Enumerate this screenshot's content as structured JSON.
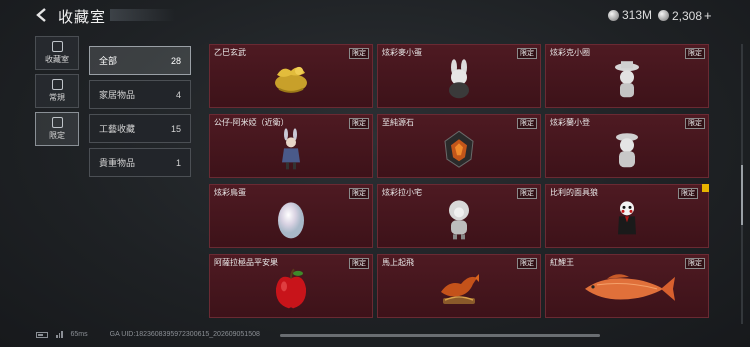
{
  "header": {
    "title": "收藏室",
    "back_icon": "back-arrow-icon"
  },
  "currency": [
    {
      "icon": "silver-coin-icon",
      "value": "313M"
    },
    {
      "icon": "silver-coin-icon",
      "value": "2,308",
      "plus": "+"
    }
  ],
  "nav_tabs": [
    {
      "label": "收藏室",
      "icon": "collection-room-icon",
      "active": false
    },
    {
      "label": "常規",
      "icon": "regular-icon",
      "active": false
    },
    {
      "label": "限定",
      "icon": "limited-icon",
      "active": true
    }
  ],
  "categories": [
    {
      "label": "全部",
      "count": "28",
      "active": true
    },
    {
      "label": "家居物品",
      "count": "4",
      "active": false
    },
    {
      "label": "工藝收藏",
      "count": "15",
      "active": false
    },
    {
      "label": "貴重物品",
      "count": "1",
      "active": false
    }
  ],
  "items": [
    {
      "name": "乙巳玄武",
      "badge": "限定",
      "icon": "golden-dragon-figurine-icon",
      "warn": false
    },
    {
      "name": "炫彩麥小蛋",
      "badge": "限定",
      "icon": "rabbit-egg-figurine-icon",
      "warn": false
    },
    {
      "name": "炫彩克小圈",
      "badge": "限定",
      "icon": "hat-figurine-icon",
      "warn": false
    },
    {
      "name": "公仔-阿米婭（近衛）",
      "badge": "限定",
      "icon": "amiya-figure-icon",
      "warn": false
    },
    {
      "name": "至純源石",
      "badge": "限定",
      "icon": "originium-stone-icon",
      "warn": false
    },
    {
      "name": "炫彩蘭小登",
      "badge": "限定",
      "icon": "silver-figurine-icon",
      "warn": false
    },
    {
      "name": "炫彩鳥蛋",
      "badge": "限定",
      "icon": "pearl-egg-icon",
      "warn": false
    },
    {
      "name": "炫彩拉小宅",
      "badge": "限定",
      "icon": "hooded-figurine-icon",
      "warn": false
    },
    {
      "name": "比利的面具狼",
      "badge": "限定",
      "icon": "billy-puppet-icon",
      "warn": true
    },
    {
      "name": "阿薩拉極品平安果",
      "badge": "限定",
      "icon": "red-apple-icon",
      "warn": false
    },
    {
      "name": "馬上起飛",
      "badge": "限定",
      "icon": "horse-statue-icon",
      "warn": false
    },
    {
      "name": "紅鯉王",
      "badge": "限定",
      "icon": "red-carp-icon",
      "warn": false
    }
  ],
  "footer": {
    "ping": "65ms",
    "uid": "GA UID:1823608395972300615_202609051508"
  },
  "colors": {
    "card_bg": "#4e1a22",
    "accent": "#e8b400"
  }
}
